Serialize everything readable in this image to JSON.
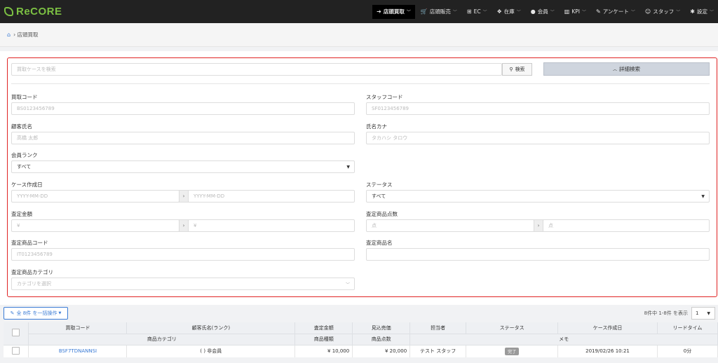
{
  "brand": {
    "name": "ReCORE",
    "color": "#7cc043"
  },
  "nav": [
    {
      "icon": "sign-in-icon",
      "glyph": "➔",
      "label": "店頭買取"
    },
    {
      "icon": "cart-icon",
      "glyph": "🛒",
      "label": "店頭販売"
    },
    {
      "icon": "sitemap-icon",
      "glyph": "⊞",
      "label": "EC"
    },
    {
      "icon": "cubes-icon",
      "glyph": "❖",
      "label": "在庫"
    },
    {
      "icon": "user-icon",
      "glyph": "●",
      "label": "会員"
    },
    {
      "icon": "bar-chart-icon",
      "glyph": "▥",
      "label": "KPI"
    },
    {
      "icon": "edit-icon",
      "glyph": "✎",
      "label": "アンケート"
    },
    {
      "icon": "staff-icon",
      "glyph": "☺",
      "label": "スタッフ"
    },
    {
      "icon": "gear-icon",
      "glyph": "✱",
      "label": "設定"
    }
  ],
  "breadcrumb": {
    "label": "店頭買取"
  },
  "search": {
    "placeholder": "買取ケースを検索",
    "button": "検索",
    "advanced": "詳細検索"
  },
  "form": {
    "kaitori_code": {
      "label": "買取コード",
      "placeholder": "BS0123456789"
    },
    "staff_code": {
      "label": "スタッフコード",
      "placeholder": "SF0123456789"
    },
    "customer_name": {
      "label": "顧客氏名",
      "placeholder": "高橋 太郎"
    },
    "name_kana": {
      "label": "氏名カナ",
      "placeholder": "タカハシ タロウ"
    },
    "member_rank": {
      "label": "会員ランク",
      "value": "すべて"
    },
    "created_date": {
      "label": "ケース作成日",
      "from": "YYYY-MM-DD",
      "to": "YYYY-MM-DD"
    },
    "status": {
      "label": "ステータス",
      "value": "すべて"
    },
    "amount": {
      "label": "査定金額",
      "from": "¥",
      "to": "¥"
    },
    "item_count": {
      "label": "査定商品点数",
      "from": "点",
      "to": "点"
    },
    "item_code": {
      "label": "査定商品コード",
      "placeholder": "IT0123456789"
    },
    "item_name": {
      "label": "査定商品名",
      "placeholder": ""
    },
    "item_category": {
      "label": "査定商品カテゴリ",
      "placeholder": "カテゴリを選択"
    }
  },
  "bulk": {
    "label": "全 8件 を一括操作"
  },
  "pager": {
    "summary": "8件中 1-8件 を表示",
    "page": "1"
  },
  "table": {
    "headers": [
      "買取コード",
      "顧客氏名(ランク)",
      "査定金額",
      "見込売価",
      "担当者",
      "ステータス",
      "ケース作成日",
      "リードタイム"
    ],
    "subheaders": [
      "商品カテゴリ",
      "商品種類",
      "商品点数",
      "メモ"
    ],
    "rows": [
      {
        "code": "BSF7TDNANNSI",
        "customer": "( ) 非会員",
        "amount": "¥ 10,000",
        "expected": "¥ 20,000",
        "staff": "テスト スタッフ",
        "status": "完了",
        "created": "2019/02/26 10:21",
        "lead": "0分"
      }
    ]
  }
}
